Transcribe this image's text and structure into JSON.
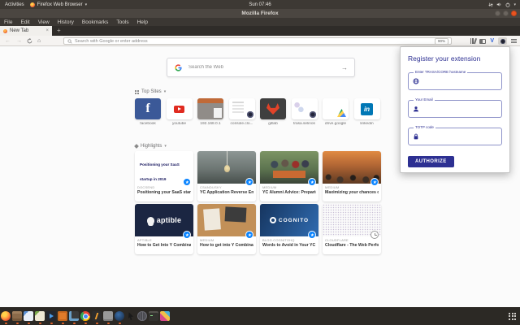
{
  "colors": {
    "ubuntu_orange": "#E95420",
    "popup_navy": "#2d3092",
    "bookmark_blue": "#0a84ff",
    "toolbar_bg": "#f5f3f1",
    "page_bg": "#fbfbfb",
    "topbar_bg": "#3d3934"
  },
  "system_bar": {
    "activities_label": "Activities",
    "app_menu_label": "Firefox Web Browser",
    "clock": "Sun 07:46"
  },
  "window": {
    "title": "Mozilla Firefox"
  },
  "menu_bar": {
    "items": [
      "File",
      "Edit",
      "View",
      "History",
      "Bookmarks",
      "Tools",
      "Help"
    ]
  },
  "tabs": {
    "active_label": "New Tab",
    "close_glyph": "×",
    "new_tab_glyph": "+"
  },
  "toolbar": {
    "back_glyph": "←",
    "forward_glyph": "→",
    "home_glyph": "⌂",
    "url_placeholder": "Search with Google or enter address",
    "zoom_level": "90%"
  },
  "newtab": {
    "search_placeholder": "Search the Web",
    "search_arrow": "→",
    "top_sites_header": "Top Sites",
    "highlights_header": "Highlights",
    "section_caret": "▾",
    "top_sites": [
      {
        "label": "facebook",
        "logo_letter": "f"
      },
      {
        "label": "youtube"
      },
      {
        "label": "192.168.0.1"
      },
      {
        "label": "console.clo..."
      },
      {
        "label": "gitlab"
      },
      {
        "label": "trasa.selinos"
      },
      {
        "label": "drive.google"
      },
      {
        "label": "linkedin",
        "logo_letter": "in"
      }
    ],
    "highlights": [
      {
        "source": "DOCSEND",
        "title": "Positioning your SaaS startup i...",
        "thumb_text": "Positioning your SaaS startup in 2019",
        "badge": "bookmark-star"
      },
      {
        "source": "CSANDUSKY",
        "title": "YC Application Reverse Engine...",
        "badge": "bookmark-star"
      },
      {
        "source": "MEDIUM",
        "title": "YC Alumni Advice: Preparing f...",
        "badge": "bookmark-star"
      },
      {
        "source": "MEDIUM",
        "title": "Maximizing your chances of ge...",
        "badge": "bookmark-star"
      },
      {
        "source": "APTIBLE",
        "title": "How to Get Into Y Combinator ...",
        "thumb_text": "aptible",
        "badge": "bookmark-star"
      },
      {
        "source": "MEDIUM",
        "title": "How to get into Y Combinator ...",
        "badge": "bookmark-star"
      },
      {
        "source": "BLOG.COGNITOHQ",
        "title": "Words to Avoid in Your YC Ap...",
        "thumb_text": "COGNITO",
        "badge": "bookmark-star"
      },
      {
        "source": "CLOUDFLARE",
        "title": "Cloudflare - The Web Perform...",
        "badge": "history-clock"
      }
    ],
    "badge_star_glyph": "★"
  },
  "popup": {
    "title": "Register your extension",
    "hostname_label": "Enter TRASA/CORE hostname",
    "email_label": "Your Email",
    "totp_label": "TOTP code",
    "authorize_label": "AUTHORIZE",
    "field_icons": [
      "globe-icon",
      "user-icon",
      "lock-icon"
    ]
  },
  "dock": {
    "items": [
      "firefox",
      "file-cabinet",
      "document-writer",
      "text-editor",
      "media-player",
      "software-center",
      "screenshot-tool",
      "chrome",
      "power-app",
      "phone",
      "app-dark-sphere",
      "pointer-tool",
      "network-globe",
      "terminal",
      "color-plugin"
    ],
    "show_apps": "show-applications-grid"
  }
}
